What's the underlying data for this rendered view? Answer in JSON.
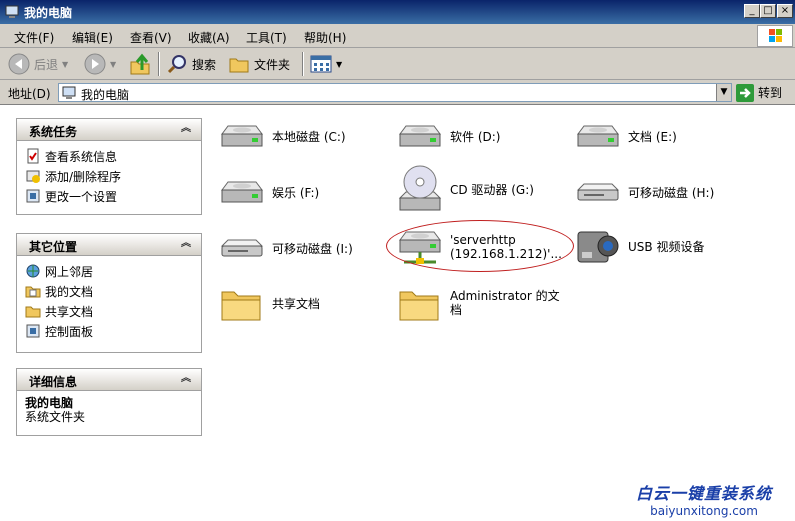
{
  "window": {
    "title": "我的电脑"
  },
  "menu": [
    "文件(F)",
    "编辑(E)",
    "查看(V)",
    "收藏(A)",
    "工具(T)",
    "帮助(H)"
  ],
  "toolbar": {
    "back": "后退",
    "search": "搜索",
    "folders": "文件夹"
  },
  "address": {
    "label": "地址(D)",
    "value": "我的电脑",
    "go": "转到"
  },
  "panels": {
    "system_tasks": {
      "title": "系统任务",
      "items": [
        "查看系统信息",
        "添加/删除程序",
        "更改一个设置"
      ]
    },
    "other_places": {
      "title": "其它位置",
      "items": [
        "网上邻居",
        "我的文档",
        "共享文档",
        "控制面板"
      ]
    },
    "details": {
      "title": "详细信息",
      "name": "我的电脑",
      "type": "系统文件夹"
    }
  },
  "items": [
    {
      "label": "本地磁盘 (C:)",
      "icon": "hard-disk-icon"
    },
    {
      "label": "软件 (D:)",
      "icon": "hard-disk-icon"
    },
    {
      "label": "文档 (E:)",
      "icon": "hard-disk-icon"
    },
    {
      "label": "娱乐 (F:)",
      "icon": "hard-disk-icon"
    },
    {
      "label": "CD 驱动器 (G:)",
      "icon": "cd-drive-icon"
    },
    {
      "label": "可移动磁盘 (H:)",
      "icon": "removable-disk-icon"
    },
    {
      "label": "可移动磁盘 (I:)",
      "icon": "removable-disk-icon"
    },
    {
      "label_line1": "'serverhttp",
      "label_line2": "(192.168.1.212)'...",
      "icon": "network-drive-icon"
    },
    {
      "label": "USB 视频设备",
      "icon": "camera-icon"
    },
    {
      "label": "共享文档",
      "icon": "folder-icon"
    },
    {
      "label_line1": "Administrator 的文",
      "label_line2": "档",
      "icon": "folder-icon"
    }
  ],
  "watermark": {
    "line1": "白云一键重装系统",
    "line2": "baiyunxitong.com"
  },
  "colors": {
    "titlebar": "#0a246a",
    "chrome": "#d4d0c8",
    "annotation": "#c02020",
    "watermark": "#1a3fa8"
  }
}
